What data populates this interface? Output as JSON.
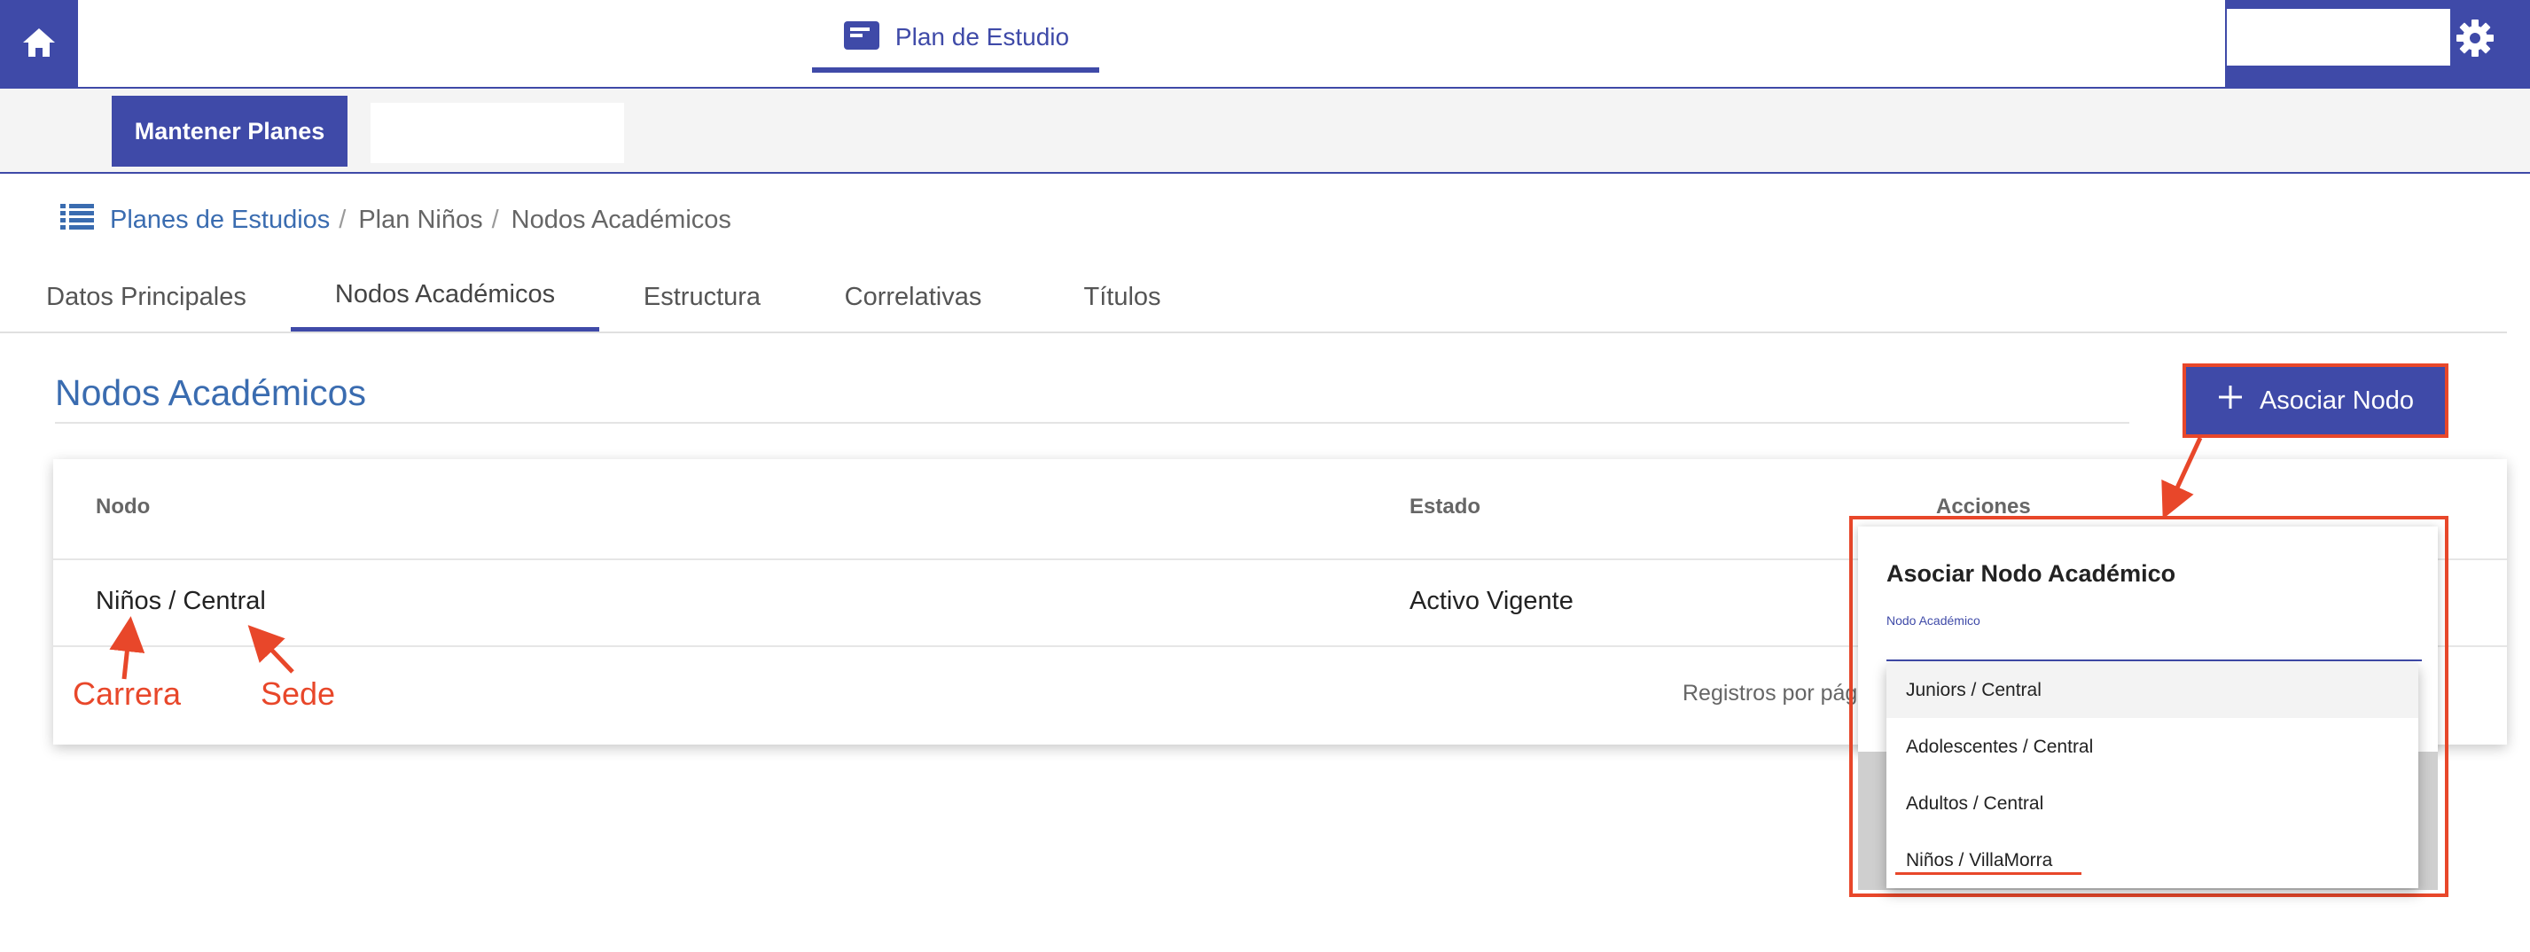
{
  "app": {
    "top_tab_label": "Plan de Estudio",
    "home_icon": "home-icon",
    "settings_icon": "gear-icon",
    "accent_color": "#3f4aa8"
  },
  "subbar": {
    "mantener_label": "Mantener Planes"
  },
  "breadcrumb": {
    "icon": "list-icon",
    "items": [
      "Planes de Estudios",
      "Plan Niños",
      "Nodos Académicos"
    ],
    "separator": "/"
  },
  "tabs": [
    "Datos Principales",
    "Nodos Académicos",
    "Estructura",
    "Correlativas",
    "Títulos"
  ],
  "active_tab": "Nodos Académicos",
  "section": {
    "title": "Nodos Académicos",
    "add_button_label": "Asociar Nodo"
  },
  "table": {
    "columns": [
      "Nodo",
      "Estado",
      "Acciones"
    ],
    "rows": [
      {
        "nodo": "Niños / Central",
        "estado": "Activo Vigente"
      }
    ],
    "footer_text": "Registros por pág"
  },
  "annotations": {
    "carrera": "Carrera",
    "sede": "Sede",
    "color": "#e8472a"
  },
  "popup": {
    "title": "Asociar Nodo Académico",
    "field_label": "Nodo Académico",
    "field_value": "",
    "options": [
      "Juniors / Central",
      "Adolescentes / Central",
      "Adultos / Central",
      "Niños / VillaMorra"
    ]
  }
}
